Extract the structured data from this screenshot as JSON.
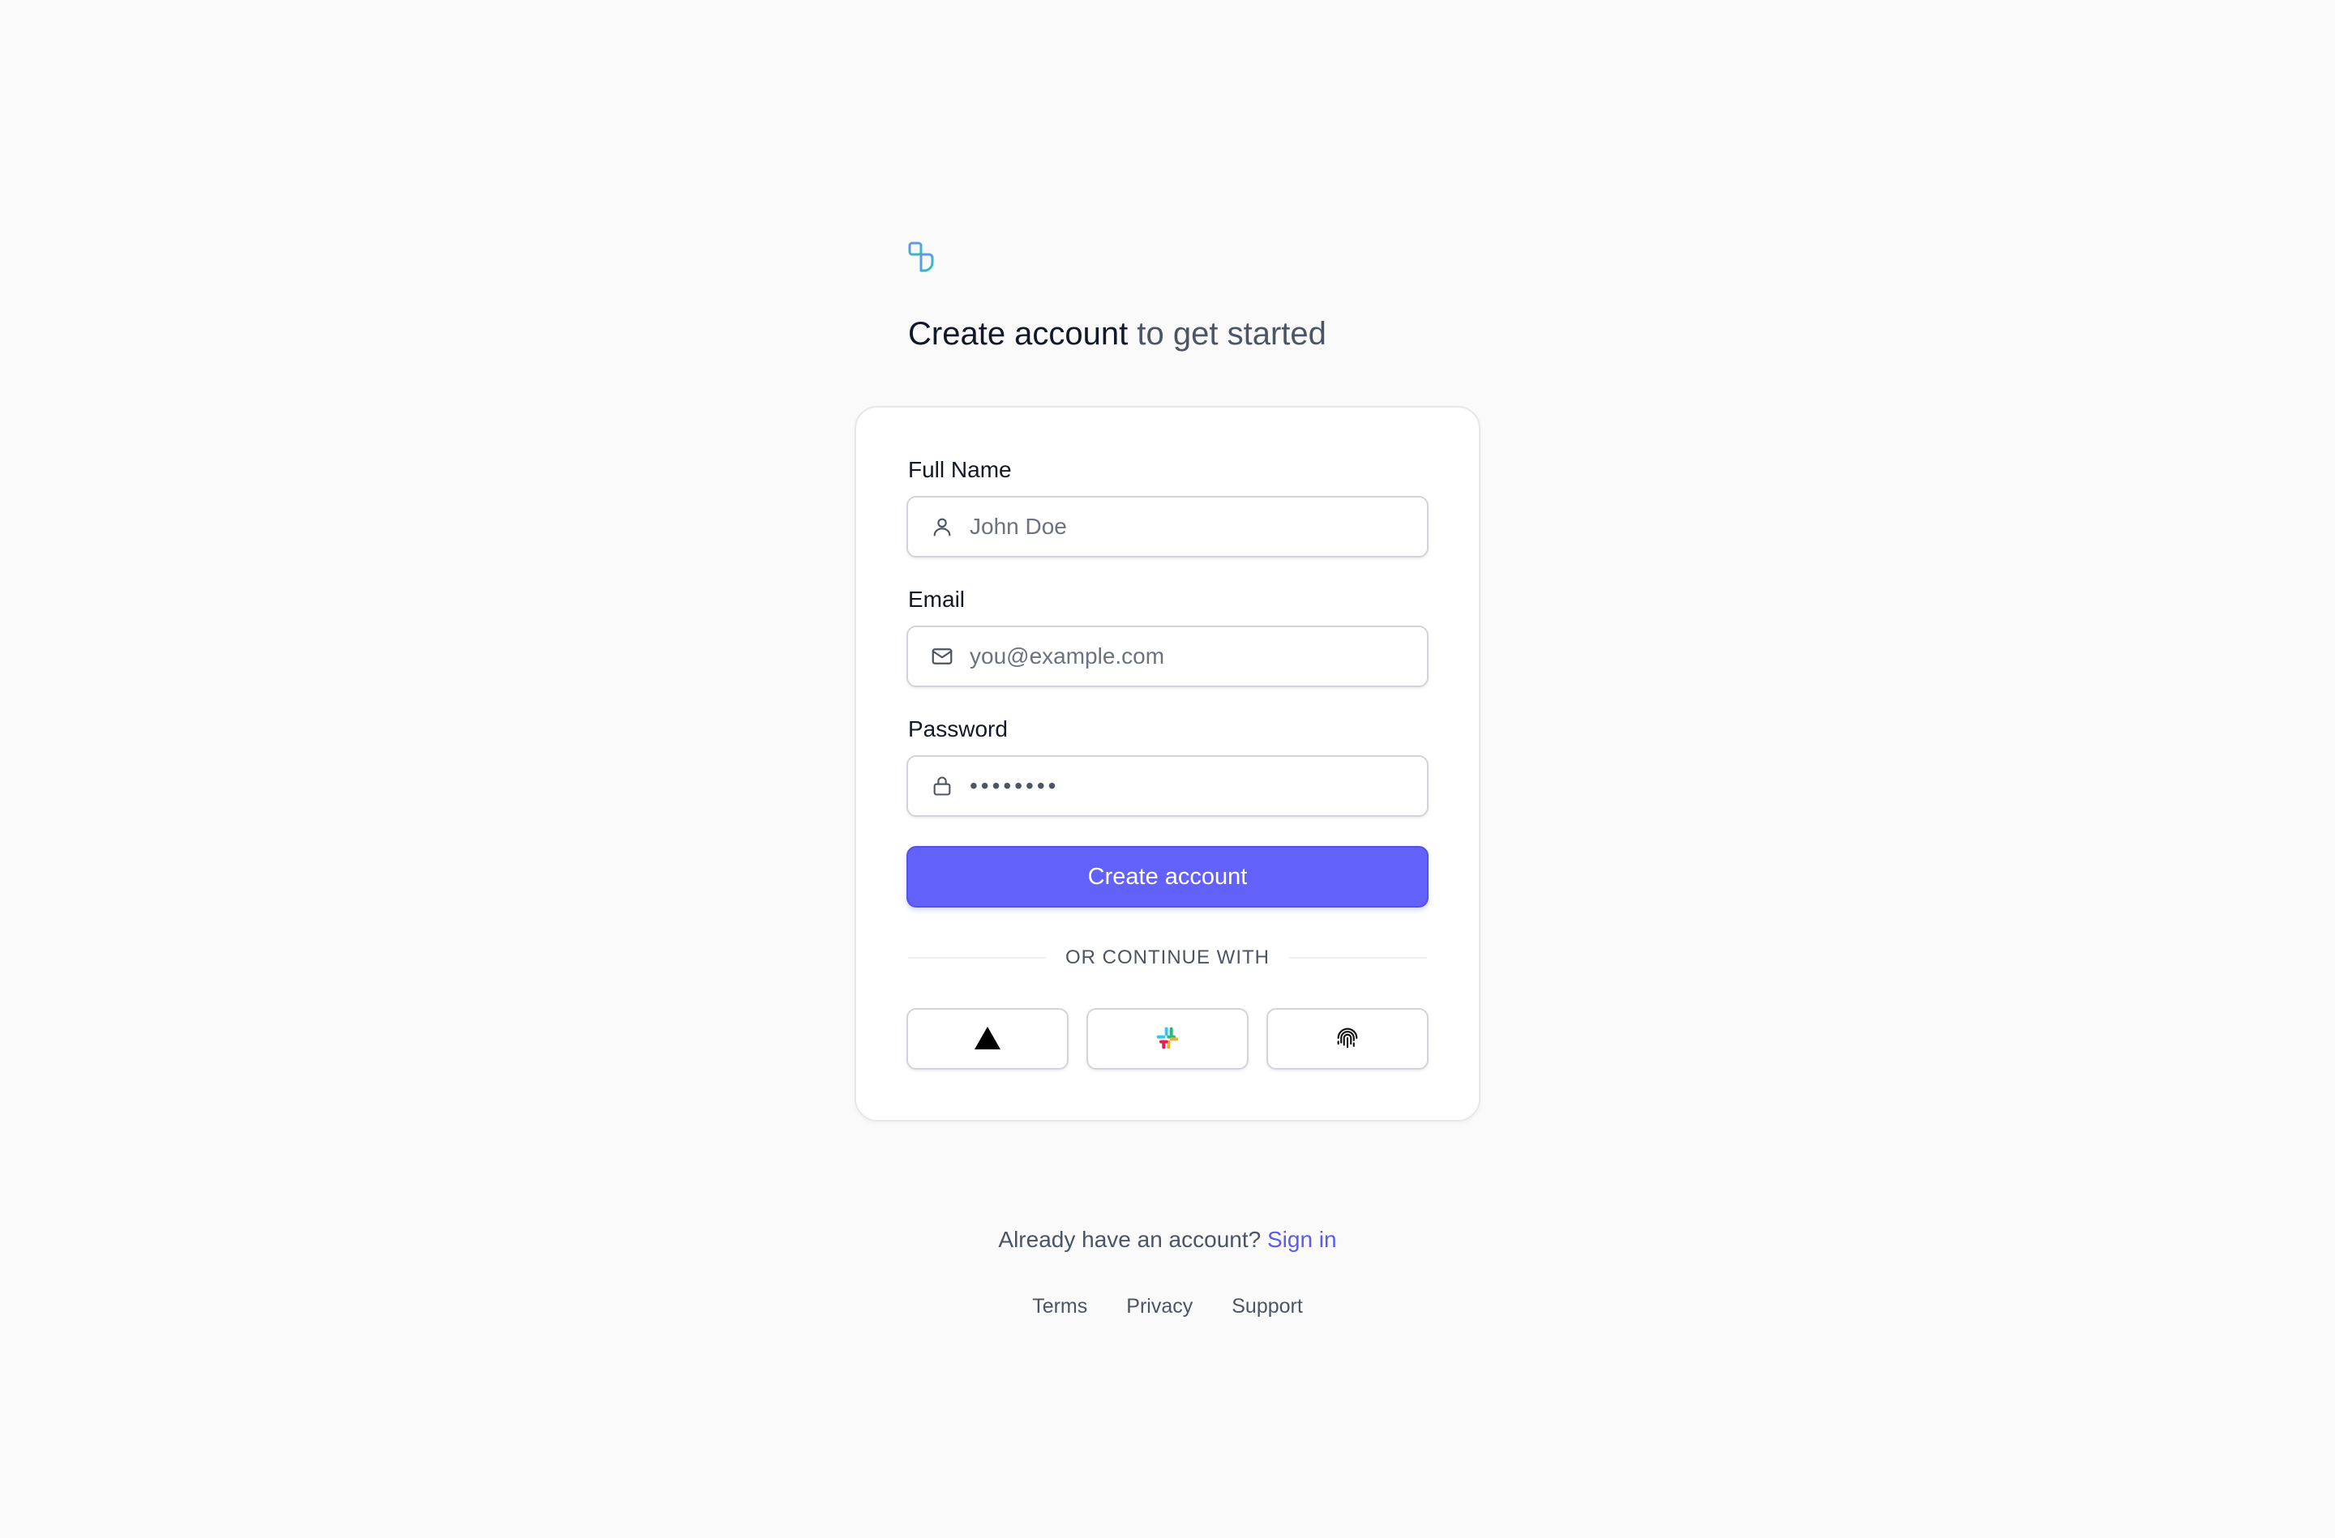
{
  "header": {
    "logo_icon": "app-logo-icon",
    "title_strong": "Create account",
    "title_muted": "to get started"
  },
  "form": {
    "full_name": {
      "label": "Full Name",
      "placeholder": "John Doe",
      "icon": "user-icon"
    },
    "email": {
      "label": "Email",
      "placeholder": "you@example.com",
      "icon": "mail-icon"
    },
    "password": {
      "label": "Password",
      "value": "password",
      "icon": "lock-icon"
    },
    "submit_label": "Create account",
    "divider_text": "OR CONTINUE WITH",
    "social": [
      {
        "icon": "vercel-triangle-icon"
      },
      {
        "icon": "slack-icon"
      },
      {
        "icon": "fingerprint-icon"
      }
    ]
  },
  "footer": {
    "prompt": "Already have an account?",
    "signin_label": "Sign in",
    "links": [
      "Terms",
      "Privacy",
      "Support"
    ]
  },
  "colors": {
    "accent": "#6262fb",
    "link": "#5b5bf0",
    "background": "#fafafa"
  }
}
